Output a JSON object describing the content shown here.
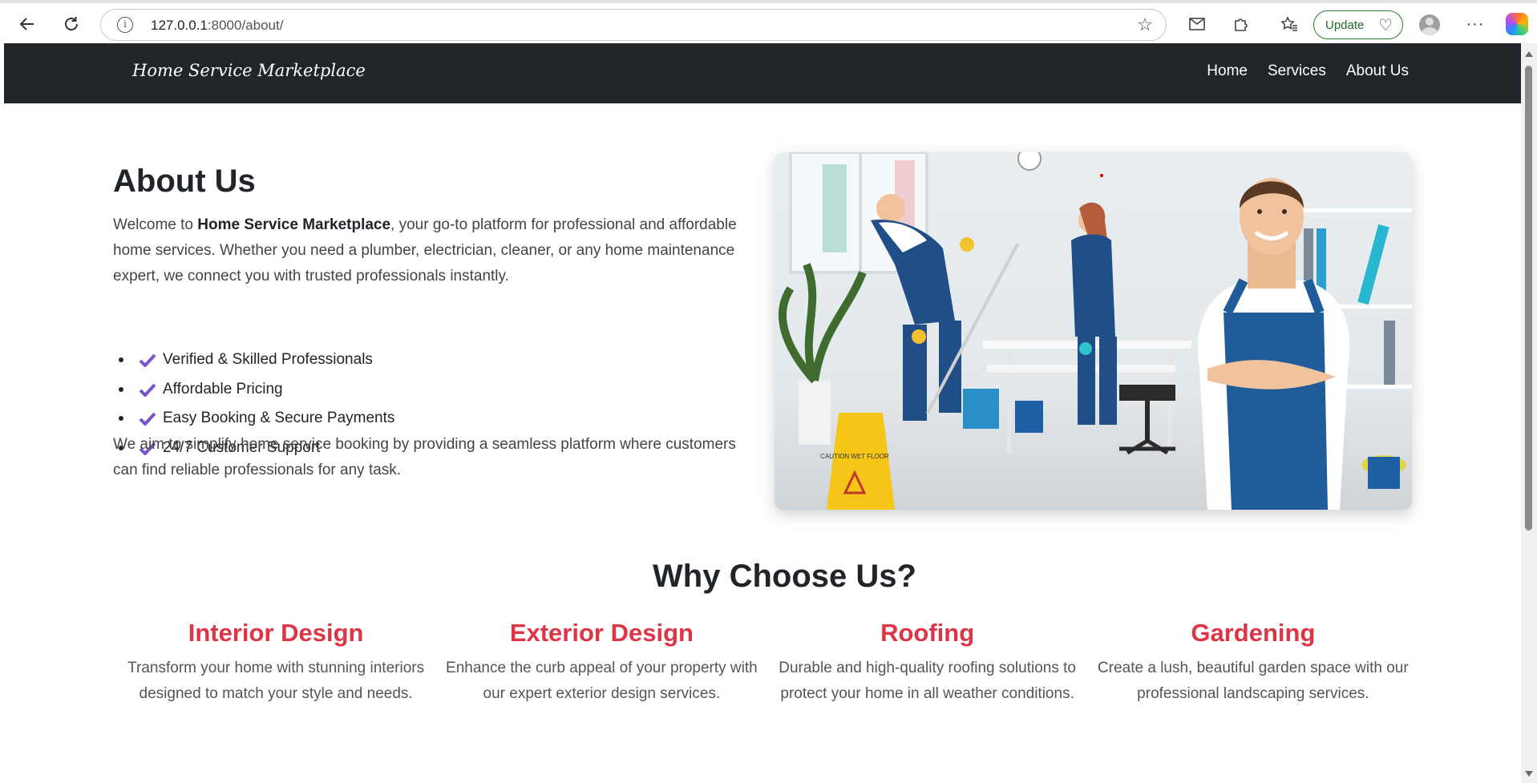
{
  "browser": {
    "url_host": "127.0.0.1",
    "url_path": ":8000/about/",
    "update_label": "Update"
  },
  "navbar": {
    "brand": "Home Service Marketplace",
    "links": [
      {
        "label": "Home"
      },
      {
        "label": "Services"
      },
      {
        "label": "About Us"
      }
    ]
  },
  "about": {
    "title": "About Us",
    "intro_before": "Welcome to ",
    "intro_bold": "Home Service Marketplace",
    "intro_after": ", your go-to platform for professional and affordable home services. Whether you need a plumber, electrician, cleaner, or any home maintenance expert, we connect you with trusted professionals instantly.",
    "features": [
      {
        "label": "Verified & Skilled Professionals"
      },
      {
        "label": "Affordable Pricing"
      },
      {
        "label": "Easy Booking & Secure Payments"
      },
      {
        "label": "24/7 Customer Support"
      }
    ],
    "mission": "We aim to simplify home service booking by providing a seamless platform where customers can find reliable professionals for any task.",
    "image_sign_text": "CAUTION WET FLOOR"
  },
  "why": {
    "title": "Why Choose Us?",
    "services": [
      {
        "title": "Interior Design",
        "desc": "Transform your home with stunning interiors designed to match your style and needs."
      },
      {
        "title": "Exterior Design",
        "desc": "Enhance the curb appeal of your property with our expert exterior design services."
      },
      {
        "title": "Roofing",
        "desc": "Durable and high-quality roofing solutions to protect your home in all weather conditions."
      },
      {
        "title": "Gardening",
        "desc": "Create a lush, beautiful garden space with our professional landscaping services."
      }
    ]
  },
  "colors": {
    "navbar_bg": "#212529",
    "accent_red": "#dc3545",
    "check_purple": "#7b52c9"
  }
}
